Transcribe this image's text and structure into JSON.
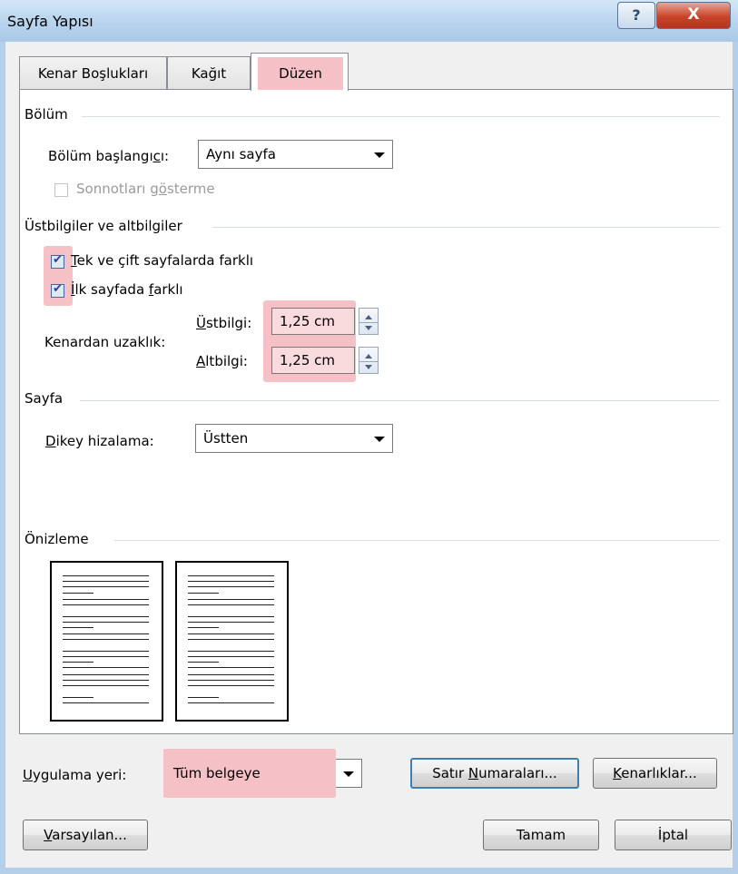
{
  "window": {
    "title": "Sayfa Yapısı",
    "help_label": "?",
    "close_label": "X"
  },
  "tabs": [
    {
      "label": "Kenar Boşlukları"
    },
    {
      "label": "Kağıt"
    },
    {
      "label": "Düzen"
    }
  ],
  "bolum": {
    "heading": "Bölüm",
    "start_label_pre": "Bölüm başlangı",
    "start_label_acc": "c",
    "start_label_post": "ı:",
    "start_value": "Aynı sayfa",
    "endnotes_label_pre": "Sonnotları g",
    "endnotes_label_acc": "ö",
    "endnotes_label_post": "sterme"
  },
  "headers": {
    "heading": "Üstbilgiler ve altbilgiler",
    "oddeven_acc": "T",
    "oddeven_rest": "ek ve çift sayfalarda farklı",
    "first_acc": "İ",
    "first_rest_pre": "lk sayfada ",
    "first_rest_acc": "f",
    "first_rest_post": "arklı",
    "distance_label": "Kenardan uzaklık:",
    "header_acc": "Ü",
    "header_rest": "stbilgi:",
    "header_value": "1,25 cm",
    "footer_acc": "A",
    "footer_rest": "ltbilgi:",
    "footer_value": "1,25 cm"
  },
  "sayfa": {
    "heading": "Sayfa",
    "valign_acc": "D",
    "valign_rest": "ikey hizalama:",
    "valign_value": "Üstten"
  },
  "preview": {
    "heading": "Önizleme"
  },
  "apply": {
    "label_acc": "U",
    "label_rest": "ygulama yeri:",
    "value": "Tüm belgeye"
  },
  "buttons": {
    "line_numbers_pre": "Satır ",
    "line_numbers_acc": "N",
    "line_numbers_post": "umaraları...",
    "borders_acc": "K",
    "borders_rest": "enarlıklar...",
    "default_acc": "V",
    "default_rest": "arsayılan...",
    "ok": "Tamam",
    "cancel": "İptal"
  },
  "colors": {
    "highlight": "#f5c1c6",
    "titlebar": "#bcd6ee",
    "dialog_bg": "#f0f0f0"
  }
}
